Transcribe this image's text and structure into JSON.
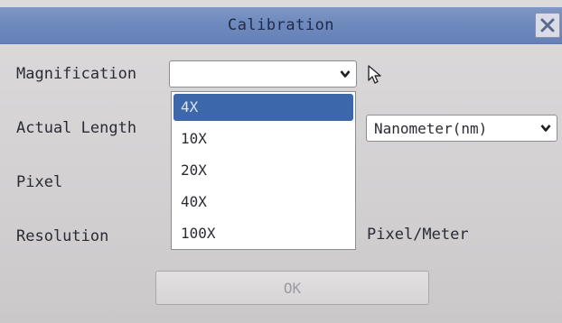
{
  "dialog": {
    "title": "Calibration",
    "close_icon": "close-icon"
  },
  "magnification": {
    "label": "Magnification",
    "value": "",
    "options": [
      "4X",
      "10X",
      "20X",
      "40X",
      "100X"
    ],
    "highlighted": "4X"
  },
  "actual_length": {
    "label": "Actual Length",
    "unit_value": "Nanometer(nm)"
  },
  "pixel": {
    "label": "Pixel"
  },
  "resolution": {
    "label": "Resolution",
    "unit": "Pixel/Meter"
  },
  "ok_button": {
    "label": "OK",
    "enabled": false
  },
  "icons": {
    "combo_arrow": "chevron-down-icon",
    "cursor": "mouse-pointer-icon"
  }
}
